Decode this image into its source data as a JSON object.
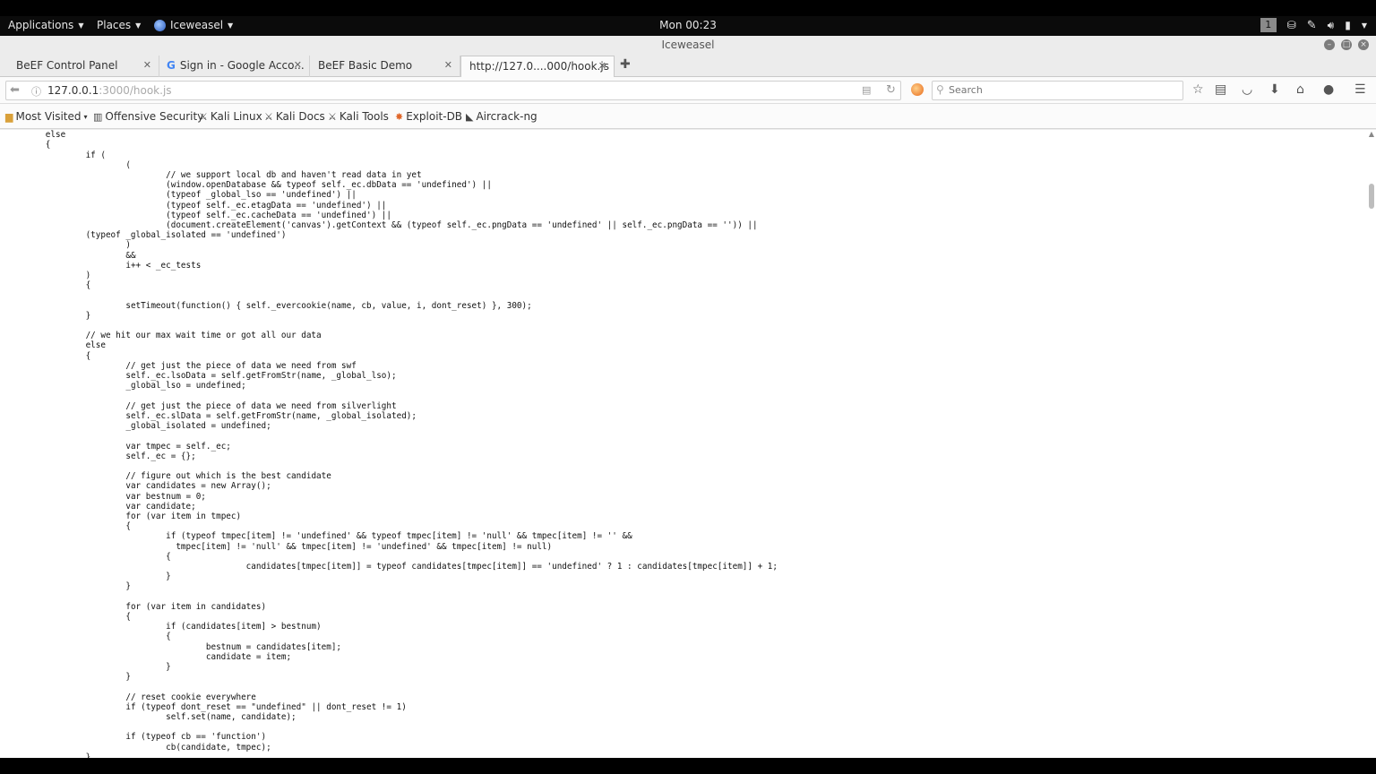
{
  "topbar": {
    "applications": "Applications",
    "places": "Places",
    "app": "Iceweasel",
    "clock": "Mon 00:23",
    "workspace": "1"
  },
  "window": {
    "title": "Iceweasel"
  },
  "tabs": [
    {
      "label": "BeEF Control Panel"
    },
    {
      "label": "Sign in - Google Acco..."
    },
    {
      "label": "BeEF Basic Demo"
    },
    {
      "label": "http://127.0....000/hook.js"
    }
  ],
  "navbar": {
    "url_host": "127.0.0.1",
    "url_rest": ":3000/hook.js",
    "search_placeholder": "Search"
  },
  "bookmarks": [
    {
      "label": "Most Visited"
    },
    {
      "label": "Offensive Security"
    },
    {
      "label": "Kali Linux"
    },
    {
      "label": "Kali Docs"
    },
    {
      "label": "Kali Tools"
    },
    {
      "label": "Exploit-DB"
    },
    {
      "label": "Aircrack-ng"
    }
  ],
  "content": {
    "code": "\t// when reading data, we need to wait for swf, db, silverlight and png\n\telse\n\t{\n\t\tif (\n\t\t\t(\n\t\t\t\t// we support local db and haven't read data in yet\n\t\t\t\t(window.openDatabase && typeof self._ec.dbData == 'undefined') ||\n\t\t\t\t(typeof _global_lso == 'undefined') ||\n\t\t\t\t(typeof self._ec.etagData == 'undefined') ||\n\t\t\t\t(typeof self._ec.cacheData == 'undefined') ||\n\t\t\t\t(document.createElement('canvas').getContext && (typeof self._ec.pngData == 'undefined' || self._ec.pngData == '')) ||\n\t\t(typeof _global_isolated == 'undefined')\n\t\t\t)\n\t\t\t&&\n\t\t\ti++ < _ec_tests\n\t\t)\n\t\t{\n\n\t\t\tsetTimeout(function() { self._evercookie(name, cb, value, i, dont_reset) }, 300);\n\t\t}\n\n\t\t// we hit our max wait time or got all our data\n\t\telse\n\t\t{\n\t\t\t// get just the piece of data we need from swf\n\t\t\tself._ec.lsoData = self.getFromStr(name, _global_lso);\n\t\t\t_global_lso = undefined;\n\n\t\t\t// get just the piece of data we need from silverlight\n\t\t\tself._ec.slData = self.getFromStr(name, _global_isolated);\n\t\t\t_global_isolated = undefined;\n\n\t\t\tvar tmpec = self._ec;\n\t\t\tself._ec = {};\n\n\t\t\t// figure out which is the best candidate\n\t\t\tvar candidates = new Array();\n\t\t\tvar bestnum = 0;\n\t\t\tvar candidate;\n\t\t\tfor (var item in tmpec)\n\t\t\t{\n\t\t\t\tif (typeof tmpec[item] != 'undefined' && typeof tmpec[item] != 'null' && tmpec[item] != '' &&\n\t\t\t\t  tmpec[item] != 'null' && tmpec[item] != 'undefined' && tmpec[item] != null)\n\t\t\t\t{\n\t\t\t\t\t\tcandidates[tmpec[item]] = typeof candidates[tmpec[item]] == 'undefined' ? 1 : candidates[tmpec[item]] + 1;\n\t\t\t\t}\n\t\t\t}\n\n\t\t\tfor (var item in candidates)\n\t\t\t{\n\t\t\t\tif (candidates[item] > bestnum)\n\t\t\t\t{\n\t\t\t\t\tbestnum = candidates[item];\n\t\t\t\t\tcandidate = item;\n\t\t\t\t}\n\t\t\t}\n\n\t\t\t// reset cookie everywhere\n\t\t\tif (typeof dont_reset == \"undefined\" || dont_reset != 1)\n\t\t\t\tself.set(name, candidate);\n\n\t\t\tif (typeof cb == 'function')\n\t\t\t\tcb(candidate, tmpec);\n\t\t}"
  },
  "icons": {
    "topbar_tray": [
      "workspace-indicator",
      "network-icon",
      "pen-icon",
      "volume-icon",
      "battery-icon",
      "chevron-down-icon"
    ],
    "toolbar": [
      "star-icon",
      "reading-list-icon",
      "pocket-icon",
      "download-icon",
      "home-icon",
      "chat-icon",
      "hamburger-menu-icon"
    ]
  }
}
